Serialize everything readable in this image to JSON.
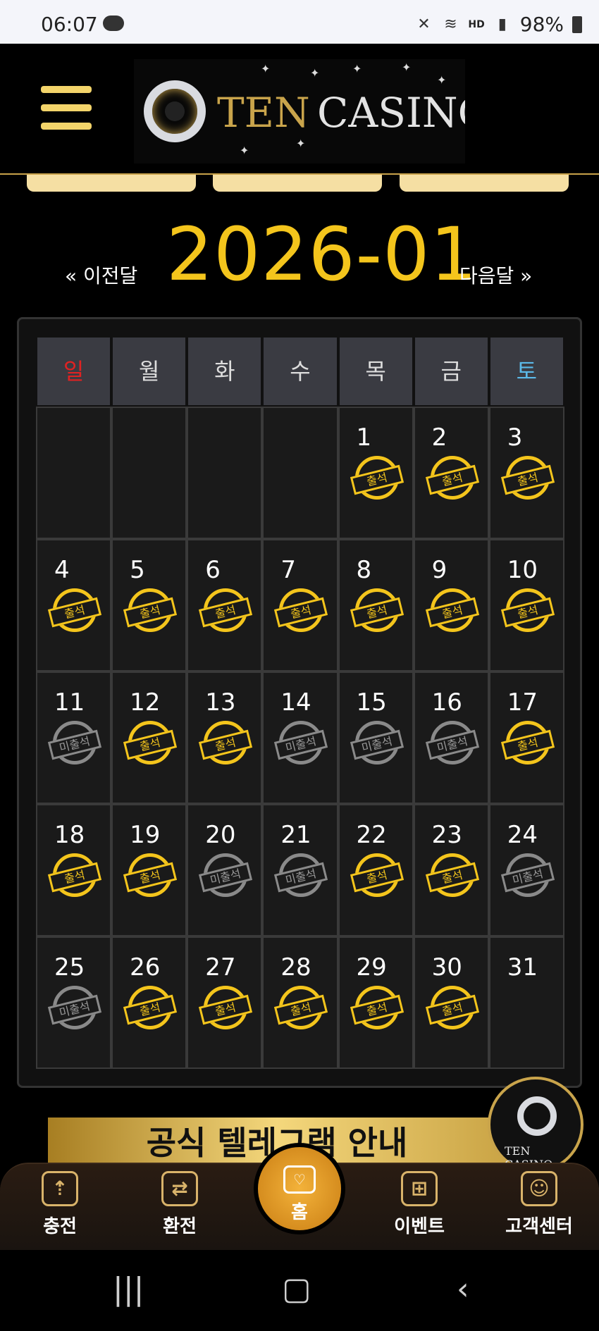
{
  "status_bar": {
    "time": "06:07",
    "right_text": "HD",
    "battery": "98%",
    "icons": [
      "cloud-icon",
      "mute-icon",
      "wifi-icon",
      "signal-icon",
      "battery-icon"
    ]
  },
  "header": {
    "logo_part1": "TEN",
    "logo_part2": "CASINO"
  },
  "month_nav": {
    "prev": "« 이전달",
    "month": "2026-01",
    "next": "다음달 »"
  },
  "calendar": {
    "weekdays": [
      "일",
      "월",
      "화",
      "수",
      "목",
      "금",
      "토"
    ],
    "present_label": "출석",
    "absent_label": "미출석",
    "weeks": [
      [
        null,
        null,
        null,
        null,
        {
          "day": "1",
          "status": "present"
        },
        {
          "day": "2",
          "status": "present"
        },
        {
          "day": "3",
          "status": "present"
        }
      ],
      [
        {
          "day": "4",
          "status": "present"
        },
        {
          "day": "5",
          "status": "present"
        },
        {
          "day": "6",
          "status": "present"
        },
        {
          "day": "7",
          "status": "present"
        },
        {
          "day": "8",
          "status": "present"
        },
        {
          "day": "9",
          "status": "present"
        },
        {
          "day": "10",
          "status": "present"
        }
      ],
      [
        {
          "day": "11",
          "status": "absent"
        },
        {
          "day": "12",
          "status": "present"
        },
        {
          "day": "13",
          "status": "present"
        },
        {
          "day": "14",
          "status": "absent"
        },
        {
          "day": "15",
          "status": "absent"
        },
        {
          "day": "16",
          "status": "absent"
        },
        {
          "day": "17",
          "status": "present"
        }
      ],
      [
        {
          "day": "18",
          "status": "present"
        },
        {
          "day": "19",
          "status": "present"
        },
        {
          "day": "20",
          "status": "absent"
        },
        {
          "day": "21",
          "status": "absent"
        },
        {
          "day": "22",
          "status": "present"
        },
        {
          "day": "23",
          "status": "present"
        },
        {
          "day": "24",
          "status": "absent"
        }
      ],
      [
        {
          "day": "25",
          "status": "absent"
        },
        {
          "day": "26",
          "status": "present"
        },
        {
          "day": "27",
          "status": "present"
        },
        {
          "day": "28",
          "status": "present"
        },
        {
          "day": "29",
          "status": "present"
        },
        {
          "day": "30",
          "status": "present"
        },
        {
          "day": "31",
          "status": "none"
        }
      ]
    ]
  },
  "banner": {
    "telegram": "공식 텔레그램 안내",
    "float_logo": "TEN CASINO"
  },
  "bottom_nav": {
    "items": [
      {
        "label": "충전",
        "icon": "charge-icon"
      },
      {
        "label": "환전",
        "icon": "exchange-icon"
      },
      {
        "label": "홈",
        "icon": "home-icon"
      },
      {
        "label": "이벤트",
        "icon": "gift-icon"
      },
      {
        "label": "고객센터",
        "icon": "support-icon"
      }
    ]
  },
  "colors": {
    "accent": "#f4c51c",
    "sunday": "#e02222",
    "saturday": "#5bb9e8"
  }
}
